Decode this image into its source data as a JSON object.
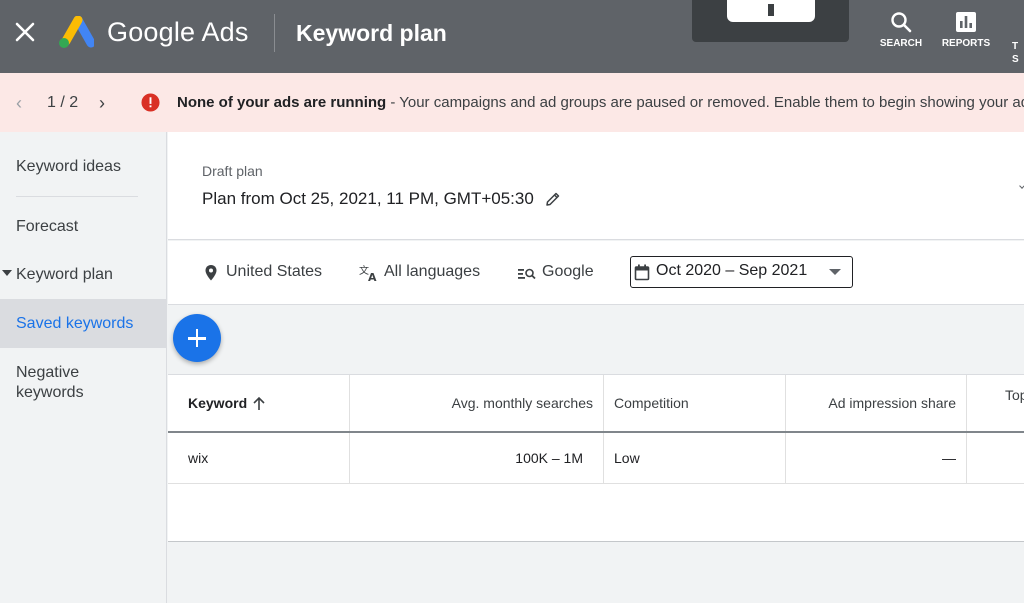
{
  "topbar": {
    "brand": "Google Ads",
    "title": "Keyword plan",
    "search_label": "SEARCH",
    "reports_label": "REPORTS",
    "tools_label_cut": "T\nS"
  },
  "banner": {
    "pagination": "1 / 2",
    "alert_bold": "None of your ads are running",
    "alert_rest": " - Your campaigns and ad groups are paused or removed. Enable them to begin showing your ads"
  },
  "sidebar": {
    "items": [
      {
        "label": "Keyword ideas"
      },
      {
        "label": "Forecast"
      },
      {
        "label": "Keyword plan"
      },
      {
        "label": "Saved keywords"
      },
      {
        "label": "Negative keywords"
      }
    ]
  },
  "plan": {
    "draft_label": "Draft plan",
    "name": "Plan from Oct 25, 2021, 11 PM, GMT+05:30"
  },
  "filters": {
    "location": "United States",
    "language": "All languages",
    "network": "Google",
    "date_range": "Oct 2020 – Sep 2021"
  },
  "table": {
    "headers": {
      "keyword": "Keyword",
      "avg_searches": "Avg. monthly searches",
      "competition": "Competition",
      "ad_impression_share": "Ad impression share",
      "top": "Top"
    },
    "rows": [
      {
        "keyword": "wix",
        "avg_searches": "100K – 1M",
        "competition": "Low",
        "ad_impression_share": "—"
      }
    ]
  },
  "colors": {
    "topbar": "#5f6368",
    "banner": "#fce8e6",
    "accent": "#1a73e8",
    "alert": "#d93025"
  }
}
